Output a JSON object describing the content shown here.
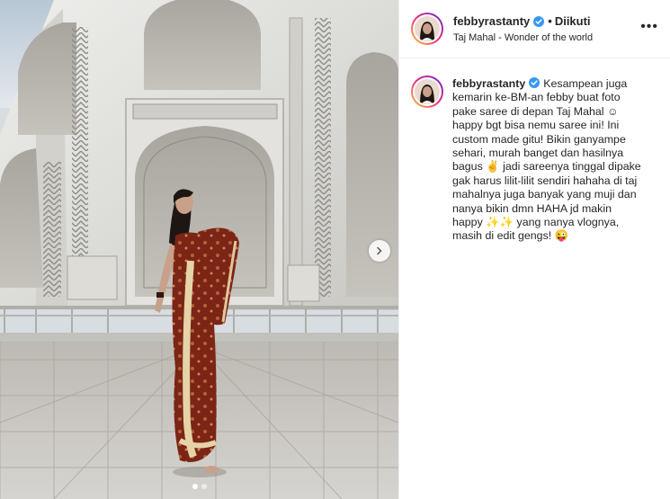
{
  "post": {
    "username": "febbyrastanty",
    "separator": "•",
    "follow_status": "Diikuti",
    "location": "Taj Mahal - Wonder of the world",
    "caption": [
      "Kesampean juga",
      "kemarin ke-BM-an febby buat foto",
      "pake saree di depan Taj Mahal ☺",
      "happy bgt bisa nemu saree ini! Ini",
      "custom made gitu! Bikin ganyampe",
      "sehari, murah banget dan hasilnya",
      "bagus ✌ jadi sareenya tinggal dipake",
      "gak harus lilit-lilit sendiri hahaha di taj",
      "mahalnya juga banyak yang muji dan",
      "nanya bikin dmn HAHA jd makin",
      "happy ✨✨ yang nanya vlognya,",
      "masih di edit gengs! 😜"
    ],
    "more_icon": "ellipsis-icon",
    "verified_icon": "verified-badge-icon",
    "next_icon": "chevron-right-icon",
    "carousel": {
      "total": 2,
      "active": 1
    }
  },
  "colors": {
    "verified": "#3897f0",
    "text": "#262626",
    "border": "#efefef",
    "saree": "#8a2a1c"
  }
}
